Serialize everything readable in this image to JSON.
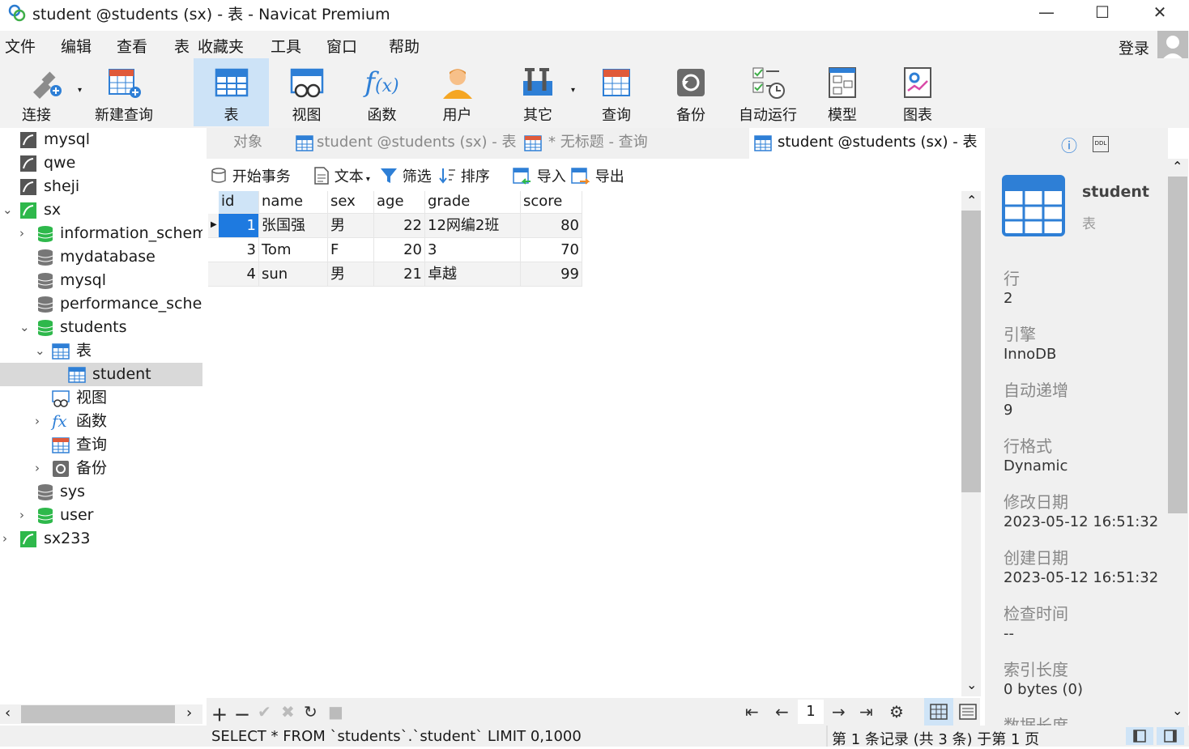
{
  "window": {
    "title": "student @students (sx) - 表 - Navicat Premium",
    "minimize": "—",
    "maximize": "☐",
    "close": "✕"
  },
  "menu": [
    "文件",
    "编辑",
    "查看",
    "表",
    "收藏夹",
    "工具",
    "窗口",
    "帮助"
  ],
  "login": "登录",
  "toolbar": [
    {
      "label": "连接",
      "icon": "connect-icon"
    },
    {
      "label": "新建查询",
      "icon": "new-query-icon"
    },
    {
      "label": "表",
      "icon": "table-icon"
    },
    {
      "label": "视图",
      "icon": "view-icon"
    },
    {
      "label": "函数",
      "icon": "function-icon"
    },
    {
      "label": "用户",
      "icon": "user-icon"
    },
    {
      "label": "其它",
      "icon": "tools-icon"
    },
    {
      "label": "查询",
      "icon": "query-icon"
    },
    {
      "label": "备份",
      "icon": "backup-icon"
    },
    {
      "label": "自动运行",
      "icon": "schedule-icon"
    },
    {
      "label": "模型",
      "icon": "model-icon"
    },
    {
      "label": "图表",
      "icon": "chart-icon"
    }
  ],
  "tree": [
    {
      "label": "mysql"
    },
    {
      "label": "qwe"
    },
    {
      "label": "sheji"
    },
    {
      "label": "sx"
    },
    {
      "label": "information_schema"
    },
    {
      "label": "mydatabase"
    },
    {
      "label": "mysql"
    },
    {
      "label": "performance_schema"
    },
    {
      "label": "students"
    },
    {
      "label": "表"
    },
    {
      "label": "student"
    },
    {
      "label": "视图"
    },
    {
      "label": "函数"
    },
    {
      "label": "查询"
    },
    {
      "label": "备份"
    },
    {
      "label": "sys"
    },
    {
      "label": "user"
    },
    {
      "label": "sx233"
    }
  ],
  "tabs": [
    "对象",
    "student @students (sx) - 表",
    "* 无标题 - 查询",
    "student @students (sx) - 表"
  ],
  "subtoolbar": {
    "begin": "开始事务",
    "text": "文本",
    "filter": "筛选",
    "sort": "排序",
    "import": "导入",
    "export": "导出"
  },
  "table": {
    "columns": [
      "id",
      "name",
      "sex",
      "age",
      "grade",
      "score"
    ],
    "rows": [
      [
        "1",
        "张国强",
        "男",
        "22",
        "12网编2班",
        "80"
      ],
      [
        "3",
        "Tom",
        "F",
        "20",
        "3",
        "70"
      ],
      [
        "4",
        "sun",
        "男",
        "21",
        "卓越",
        "99"
      ]
    ]
  },
  "pager": {
    "page": "1"
  },
  "status": {
    "sql": "SELECT * FROM `students`.`student` LIMIT 0,1000",
    "record": "第 1 条记录 (共 3 条) 于第 1 页"
  },
  "info": {
    "name": "student",
    "type": "表",
    "fields": [
      {
        "label": "行",
        "value": "2"
      },
      {
        "label": "引擎",
        "value": "InnoDB"
      },
      {
        "label": "自动递增",
        "value": "9"
      },
      {
        "label": "行格式",
        "value": "Dynamic"
      },
      {
        "label": "修改日期",
        "value": "2023-05-12 16:51:32"
      },
      {
        "label": "创建日期",
        "value": "2023-05-12 16:51:32"
      },
      {
        "label": "检查时间",
        "value": "--"
      },
      {
        "label": "索引长度",
        "value": "0 bytes (0)"
      },
      {
        "label": "数据长度",
        "value": ""
      }
    ]
  }
}
